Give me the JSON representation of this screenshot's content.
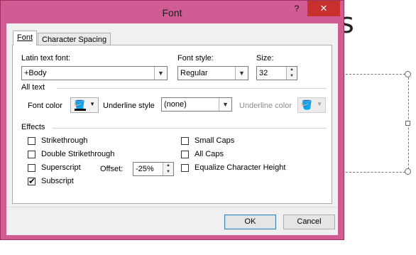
{
  "dialog": {
    "title": "Font",
    "help_label": "?",
    "close_label": "✕"
  },
  "tabs": [
    {
      "label": "Font",
      "active": true
    },
    {
      "label": "Character Spacing",
      "active": false
    }
  ],
  "font_tab": {
    "latin_font": {
      "label": "Latin text font:",
      "value": "+Body"
    },
    "font_style": {
      "label": "Font style:",
      "value": "Regular"
    },
    "size": {
      "label": "Size:",
      "value": "32"
    },
    "all_text": {
      "heading": "All text",
      "font_color_label": "Font color",
      "underline_style_label": "Underline style",
      "underline_style_value": "(none)",
      "underline_color_label": "Underline color"
    },
    "effects": {
      "heading": "Effects",
      "checkboxes": [
        {
          "label": "Strikethrough",
          "checked": false
        },
        {
          "label": "Double Strikethrough",
          "checked": false
        },
        {
          "label": "Superscript",
          "checked": false
        },
        {
          "label": "Subscript",
          "checked": true
        },
        {
          "label": "Small Caps",
          "checked": false
        },
        {
          "label": "All Caps",
          "checked": false
        },
        {
          "label": "Equalize Character Height",
          "checked": false
        }
      ],
      "offset_label": "Offset:",
      "offset_value": "-25%"
    }
  },
  "footer": {
    "ok_label": "OK",
    "cancel_label": "Cancel"
  },
  "background": {
    "slide_text": "s"
  },
  "colors": {
    "window_frame": "#d15c94",
    "close_button": "#c7302f",
    "dialog_bg": "#f0f0f0",
    "default_button_border": "#3c7fb1"
  },
  "icons": {
    "font_color": "paint-bucket-icon",
    "underline_color": "paint-bucket-icon",
    "dropdown": "chevron-down-icon",
    "spin": "spin-arrows-icon",
    "check": "checkmark-icon"
  }
}
